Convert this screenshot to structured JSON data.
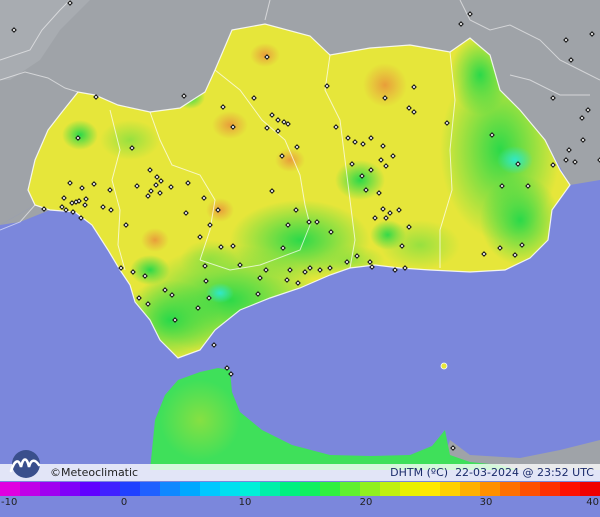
{
  "brand": {
    "copyright": "©",
    "name": "Meteoclimatic"
  },
  "stamp": {
    "variable": "DHTM (ºC)",
    "datetime": "22-03-2024 @ 23:52 UTC"
  },
  "legend": {
    "ticks": [
      "-10",
      "0",
      "10",
      "20",
      "30",
      "40"
    ],
    "min": -10,
    "max": 40,
    "colors": [
      "#e000e0",
      "#c000e8",
      "#a000f0",
      "#8000f8",
      "#6000ff",
      "#4020ff",
      "#2040ff",
      "#2060ff",
      "#1088ff",
      "#00a8ff",
      "#00c8ff",
      "#00e0f0",
      "#00f0d8",
      "#00f0a8",
      "#00f080",
      "#10f060",
      "#30f040",
      "#60f030",
      "#90f020",
      "#c0f010",
      "#e8f000",
      "#ffe800",
      "#ffd000",
      "#ffb000",
      "#ff9000",
      "#ff7000",
      "#ff5000",
      "#ff3000",
      "#ff1000",
      "#f00000"
    ]
  },
  "colors": {
    "sea": "#7b87dc",
    "land_outside": "#9fa3a8",
    "land_inside": "#e6e63a",
    "cool_zone": "#3fe05a",
    "mid_zone": "#a8e63a",
    "warm_zone": "#e8b040",
    "border": "#ffffff"
  }
}
